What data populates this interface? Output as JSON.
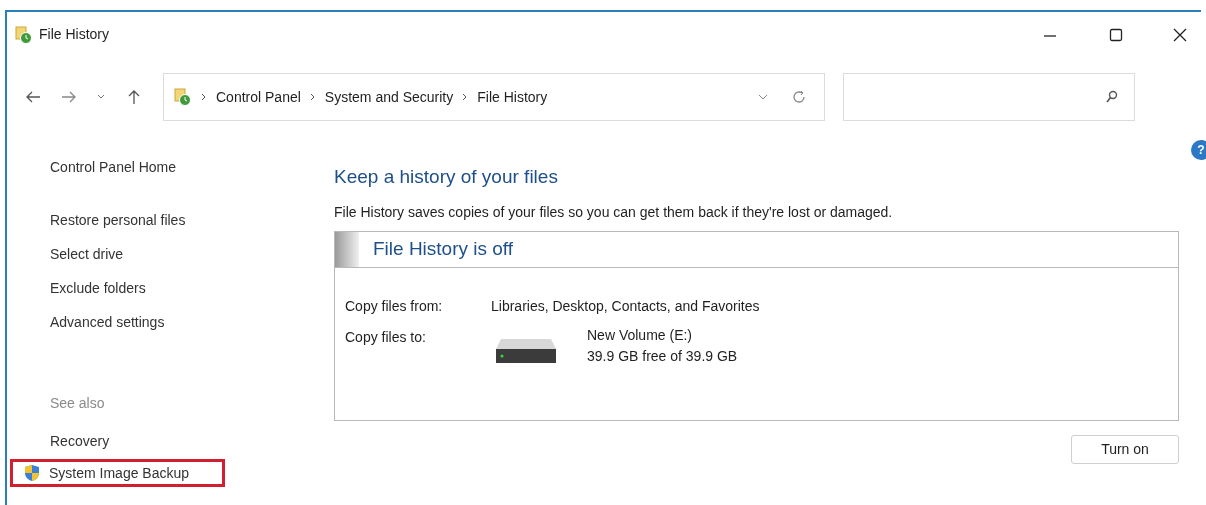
{
  "window": {
    "title": "File History"
  },
  "address_bar": {
    "crumbs": [
      "Control Panel",
      "System and Security",
      "File History"
    ]
  },
  "help": {
    "label": "?"
  },
  "sidebar": {
    "items": [
      {
        "label": "Control Panel Home",
        "kind": "home"
      },
      {
        "label": "Restore personal files",
        "kind": "link"
      },
      {
        "label": "Select drive",
        "kind": "link"
      },
      {
        "label": "Exclude folders",
        "kind": "link"
      },
      {
        "label": "Advanced settings",
        "kind": "link"
      }
    ],
    "see_also": {
      "heading": "See also",
      "items": [
        {
          "label": "Recovery",
          "shield": false,
          "highlighted": false
        },
        {
          "label": "System Image Backup",
          "shield": true,
          "highlighted": true
        }
      ]
    }
  },
  "main": {
    "heading": "Keep a history of your files",
    "description": "File History saves copies of your files so you can get them back if they're lost or damaged.",
    "status": {
      "title": "File History is off",
      "on": false
    },
    "copy_from": {
      "label": "Copy files from:",
      "value": "Libraries, Desktop, Contacts, and Favorites"
    },
    "copy_to": {
      "label": "Copy files to:",
      "drive_name": "New Volume (E:)",
      "drive_space": "39.9 GB free of 39.9 GB"
    },
    "button": "Turn on"
  }
}
